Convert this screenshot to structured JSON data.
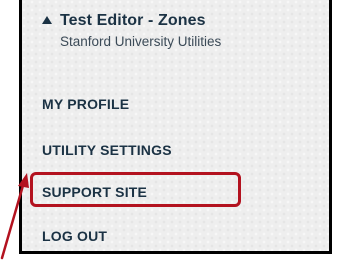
{
  "header": {
    "caret_icon": "caret-up-icon",
    "user_name": "Test Editor - Zones",
    "organization": "Stanford University Utilities"
  },
  "menu": {
    "items": [
      {
        "label": "MY PROFILE"
      },
      {
        "label": "UTILITY SETTINGS"
      },
      {
        "label": "SUPPORT SITE"
      },
      {
        "label": "LOG OUT"
      }
    ]
  },
  "annotation": {
    "highlight_color": "#b3121f",
    "arrow_icon": "arrow-icon"
  },
  "colors": {
    "text": "#1b3244",
    "menu_background": "#eeeeee"
  }
}
